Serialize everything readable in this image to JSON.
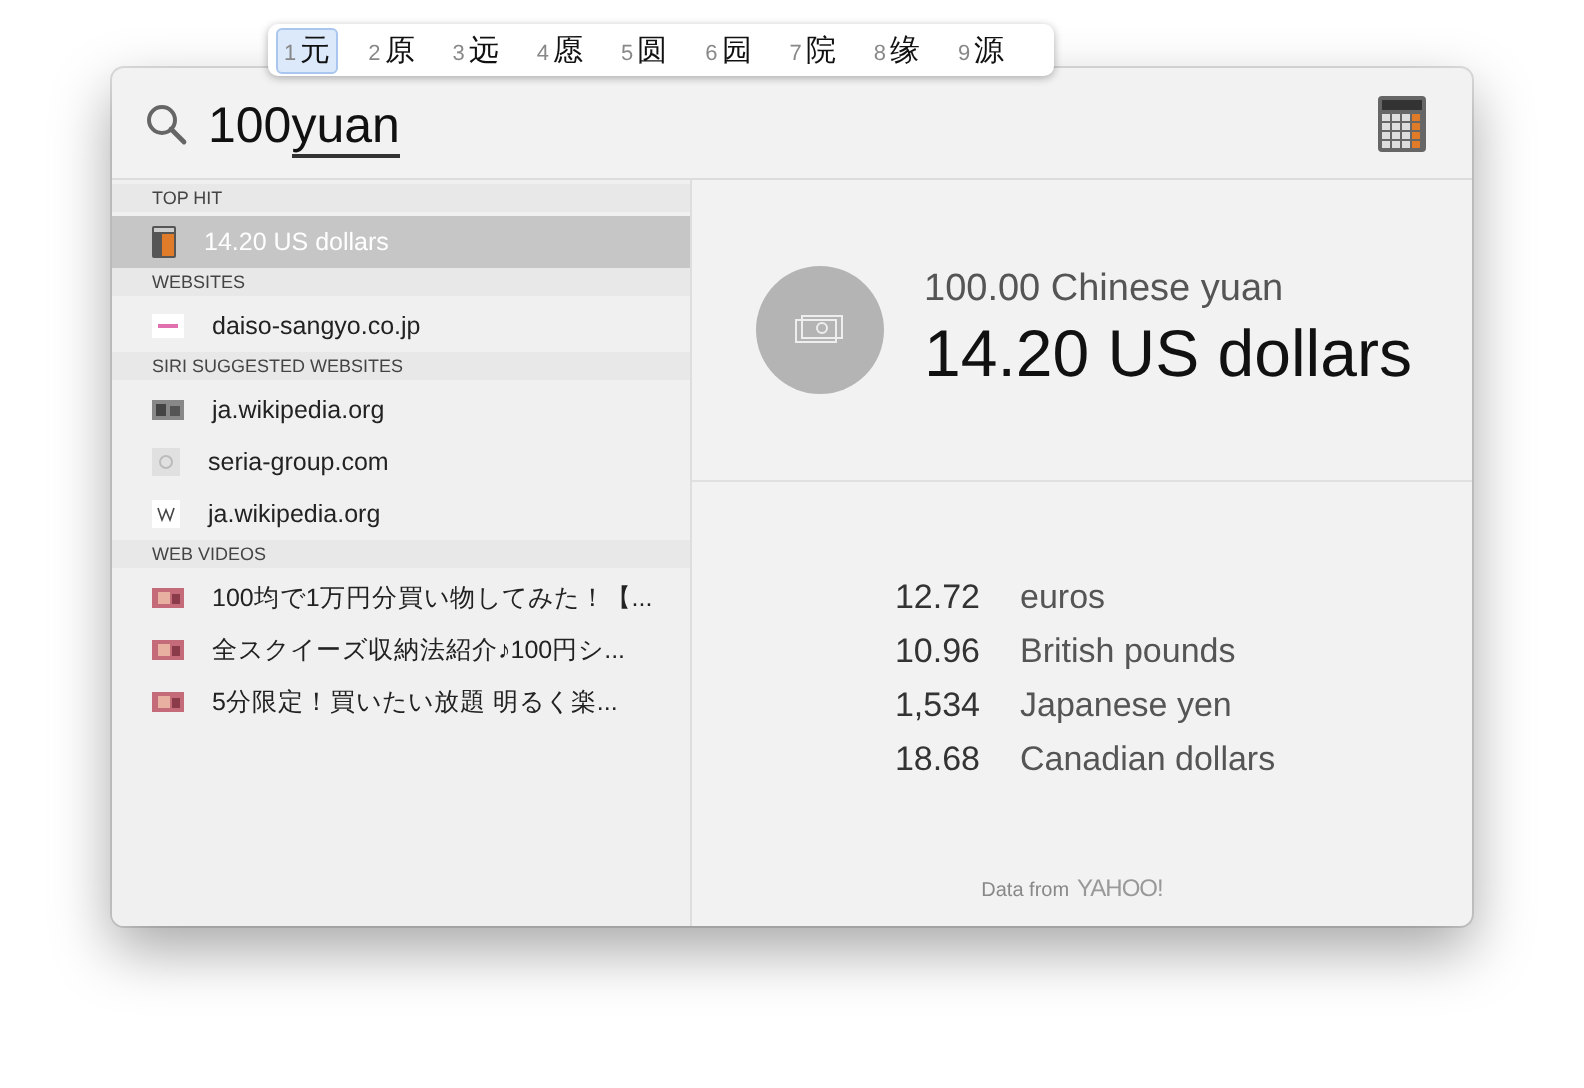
{
  "candidates": [
    {
      "number": "1",
      "text": "元",
      "selected": true
    },
    {
      "number": "2",
      "text": "原",
      "selected": false
    },
    {
      "number": "3",
      "text": "远",
      "selected": false
    },
    {
      "number": "4",
      "text": "愿",
      "selected": false
    },
    {
      "number": "5",
      "text": "圆",
      "selected": false
    },
    {
      "number": "6",
      "text": "园",
      "selected": false
    },
    {
      "number": "7",
      "text": "院",
      "selected": false
    },
    {
      "number": "8",
      "text": "缘",
      "selected": false
    },
    {
      "number": "9",
      "text": "源",
      "selected": false
    }
  ],
  "search": {
    "value": "100",
    "composing": "yuan"
  },
  "sections": [
    {
      "header": "TOP HIT",
      "items": [
        {
          "label": "14.20 US dollars",
          "kind": "calculator",
          "selected": true
        }
      ]
    },
    {
      "header": "WEBSITES",
      "items": [
        {
          "label": "daiso-sangyo.co.jp",
          "kind": "website",
          "selected": false
        }
      ]
    },
    {
      "header": "SIRI SUGGESTED WEBSITES",
      "items": [
        {
          "label": "ja.wikipedia.org",
          "kind": "thumbnail",
          "selected": false
        },
        {
          "label": "seria-group.com",
          "kind": "placeholder",
          "selected": false
        },
        {
          "label": "ja.wikipedia.org",
          "kind": "wiki",
          "selected": false
        }
      ]
    },
    {
      "header": "WEB VIDEOS",
      "items": [
        {
          "label": "100均で1万円分買い物してみた！【...",
          "kind": "video",
          "selected": false
        },
        {
          "label": "全スクイーズ収納法紹介♪100円シ...",
          "kind": "video",
          "selected": false
        },
        {
          "label": "5分限定！買いたい放題   明るく楽...",
          "kind": "video",
          "selected": false
        }
      ]
    }
  ],
  "preview": {
    "source": "100.00 Chinese yuan",
    "result": "14.20 US dollars",
    "conversions": [
      {
        "amount": "12.72",
        "currency": "euros"
      },
      {
        "amount": "10.96",
        "currency": "British pounds"
      },
      {
        "amount": "1,534",
        "currency": "Japanese yen"
      },
      {
        "amount": "18.68",
        "currency": "Canadian dollars"
      }
    ],
    "footer_label": "Data from",
    "footer_brand": "YAHOO!"
  }
}
